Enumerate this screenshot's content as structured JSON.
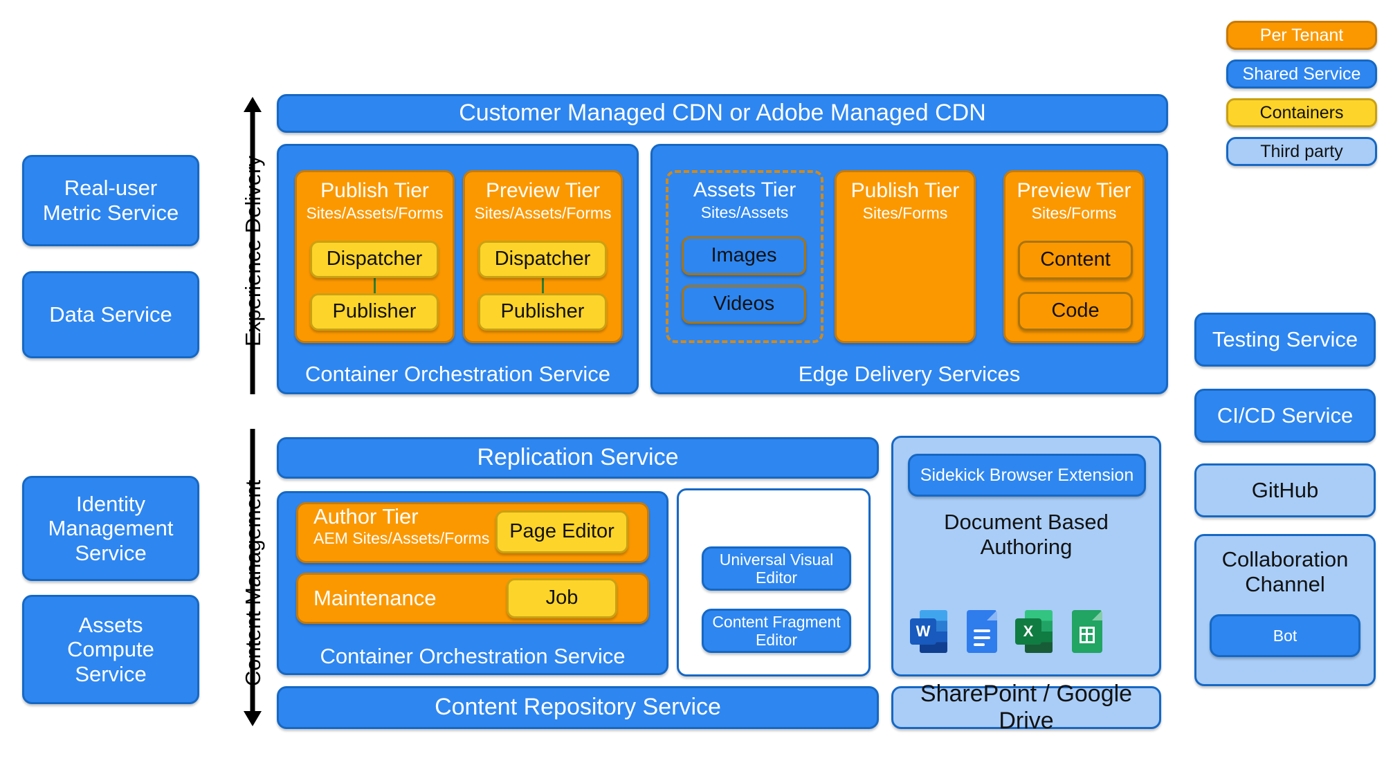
{
  "legend": {
    "items": [
      {
        "label": "Per Tenant",
        "style": "orange"
      },
      {
        "label": "Shared Service",
        "style": "blue"
      },
      {
        "label": "Containers",
        "style": "yellow"
      },
      {
        "label": "Third party",
        "style": "lightblue"
      }
    ]
  },
  "axes": {
    "experience_delivery": "Experience Delivery",
    "content_management": "Content Management"
  },
  "left_services": [
    {
      "label_line1": "Real-user",
      "label_line2": "Metric Service"
    },
    {
      "label_line1": "Data Service",
      "label_line2": ""
    },
    {
      "label_line1": "Identity",
      "label_line2": "Management",
      "label_line3": "Service"
    },
    {
      "label_line1": "Assets",
      "label_line2": "Compute",
      "label_line3": "Service"
    }
  ],
  "experience_delivery": {
    "cdn": "Customer Managed CDN or Adobe Managed CDN",
    "container_orchestration": {
      "footer": "Container Orchestration Service",
      "tiers": [
        {
          "title": "Publish Tier",
          "subtitle": "Sites/Assets/Forms",
          "children": [
            "Dispatcher",
            "Publisher"
          ]
        },
        {
          "title": "Preview Tier",
          "subtitle": "Sites/Assets/Forms",
          "children": [
            "Dispatcher",
            "Publisher"
          ]
        }
      ]
    },
    "edge_delivery": {
      "footer": "Edge Delivery Services",
      "tiers": [
        {
          "title": "Assets Tier",
          "subtitle": "Sites/Assets",
          "style": "dashed",
          "children": [
            "Images",
            "Videos"
          ]
        },
        {
          "title": "Publish Tier",
          "subtitle": "Sites/Forms",
          "style": "orange",
          "children": []
        },
        {
          "title": "Preview Tier",
          "subtitle": "Sites/Forms",
          "style": "orange",
          "children": [
            "Content",
            "Code"
          ]
        }
      ]
    }
  },
  "content_management": {
    "replication_service": "Replication Service",
    "content_repository_service": "Content Repository Service",
    "container_orchestration": {
      "footer": "Container Orchestration Service",
      "rows": [
        {
          "title": "Author Tier",
          "subtitle": "AEM Sites/Assets/Forms",
          "chip": "Page Editor"
        },
        {
          "title": "Maintenance",
          "subtitle": "",
          "chip": "Job"
        }
      ]
    },
    "editors_panel": {
      "items": [
        {
          "line1": "Universal Visual",
          "line2": "Editor"
        },
        {
          "line1": "Content Fragment",
          "line2": "Editor"
        }
      ]
    },
    "document_based_authoring": {
      "sidekick": "Sidekick Browser Extension",
      "title_line1": "Document Based",
      "title_line2": "Authoring",
      "apps": [
        "microsoft-word",
        "google-docs",
        "microsoft-excel",
        "google-sheets"
      ],
      "storage": "SharePoint / Google Drive"
    }
  },
  "right_services": [
    {
      "label": "Testing Service",
      "style": "blue"
    },
    {
      "label": "CI/CD Service",
      "style": "blue"
    },
    {
      "label": "GitHub",
      "style": "lightblue"
    }
  ],
  "collaboration": {
    "title_line1": "Collaboration",
    "title_line2": "Channel",
    "bot": "Bot"
  },
  "colors": {
    "blue": "#2e86f0",
    "blue_border": "#1668c4",
    "orange": "#fb9800",
    "orange_border": "#c87a06",
    "yellow": "#fdd429",
    "yellow_border": "#c9a114",
    "light_blue": "#a9cdf7",
    "connector_green": "#2f7d32"
  }
}
